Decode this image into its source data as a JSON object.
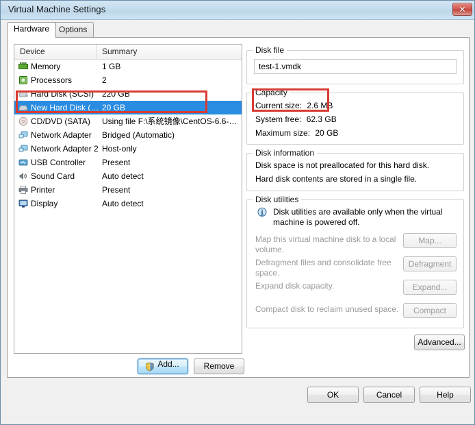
{
  "window": {
    "title": "Virtual Machine Settings",
    "close_icon": "close-icon",
    "close_glyph": "✕"
  },
  "tabs": [
    {
      "label": "Hardware",
      "active": true
    },
    {
      "label": "Options",
      "active": false
    }
  ],
  "device_list": {
    "columns": [
      "Device",
      "Summary"
    ],
    "rows": [
      {
        "icon": "memory-icon",
        "name": "Memory",
        "summary": "1 GB",
        "selected": false
      },
      {
        "icon": "processor-icon",
        "name": "Processors",
        "summary": "2",
        "selected": false
      },
      {
        "icon": "harddisk-icon",
        "name": "Hard Disk (SCSI)",
        "summary": "220 GB",
        "selected": false
      },
      {
        "icon": "harddisk-icon",
        "name": "New Hard Disk (…",
        "summary": "20 GB",
        "selected": true
      },
      {
        "icon": "cddvd-icon",
        "name": "CD/DVD (SATA)",
        "summary": "Using file F:\\系统镜像\\CentOS-6.6-…",
        "selected": false
      },
      {
        "icon": "network-adapter-icon",
        "name": "Network Adapter",
        "summary": "Bridged (Automatic)",
        "selected": false
      },
      {
        "icon": "network-adapter-icon",
        "name": "Network Adapter 2",
        "summary": "Host-only",
        "selected": false
      },
      {
        "icon": "usb-controller-icon",
        "name": "USB Controller",
        "summary": "Present",
        "selected": false
      },
      {
        "icon": "sound-card-icon",
        "name": "Sound Card",
        "summary": "Auto detect",
        "selected": false
      },
      {
        "icon": "printer-icon",
        "name": "Printer",
        "summary": "Present",
        "selected": false
      },
      {
        "icon": "display-icon",
        "name": "Display",
        "summary": "Auto detect",
        "selected": false
      }
    ],
    "add_label": "Add...",
    "remove_label": "Remove"
  },
  "disk_file": {
    "group_label": "Disk file",
    "value": "test-1.vmdk"
  },
  "capacity": {
    "group_label": "Capacity",
    "current_size_label": "Current size:",
    "current_size_value": "2.6 MB",
    "system_free_label": "System free:",
    "system_free_value": "62.3 GB",
    "maximum_size_label": "Maximum size:",
    "maximum_size_value": "20 GB"
  },
  "disk_information": {
    "group_label": "Disk information",
    "line1": "Disk space is not preallocated for this hard disk.",
    "line2": "Hard disk contents are stored in a single file."
  },
  "disk_utilities": {
    "group_label": "Disk utilities",
    "note": "Disk utilities are available only when the virtual machine is powered off.",
    "rows": [
      {
        "text": "Map this virtual machine disk to a local volume.",
        "button": "Map...",
        "has_info_icon": true
      },
      {
        "text": "Defragment files and consolidate free space.",
        "button": "Defragment",
        "has_info_icon": false
      },
      {
        "text": "Expand disk capacity.",
        "button": "Expand...",
        "has_info_icon": false
      },
      {
        "text": "Compact disk to reclaim unused space.",
        "button": "Compact",
        "has_info_icon": false
      }
    ],
    "advanced_label": "Advanced..."
  },
  "dialog_buttons": {
    "ok": "OK",
    "cancel": "Cancel",
    "help": "Help"
  },
  "colors": {
    "selection_blue": "#2a8ce0",
    "annotation_red": "#d93a32",
    "title_bar": "#c5dcee"
  }
}
